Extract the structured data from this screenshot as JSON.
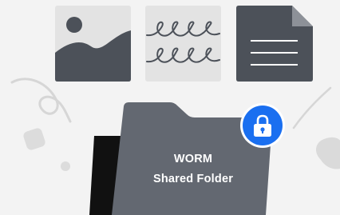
{
  "folder": {
    "title": "WORM",
    "subtitle": "Shared Folder"
  },
  "icons": {
    "image_card": "image-file-icon",
    "handwriting_card": "handwriting-file-icon",
    "document_card": "text-document-icon",
    "lock_badge": "lock-icon"
  },
  "colors": {
    "background": "#f3f3f3",
    "card_light": "#e3e3e3",
    "card_dark": "#4c5159",
    "folder": "#636871",
    "folder_back": "#111111",
    "lock_badge": "#1a6ff0",
    "decoration": "#d9d9d9"
  }
}
